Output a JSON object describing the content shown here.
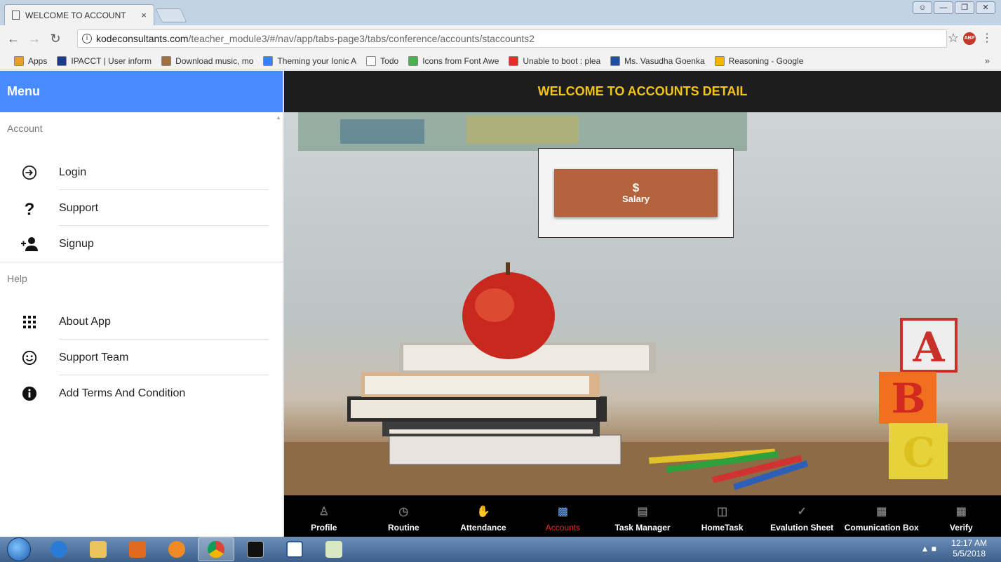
{
  "browser": {
    "tab_title": "WELCOME TO ACCOUNT",
    "tab_close": "×",
    "url_host": "kodeconsultants.com",
    "url_path": "/teacher_module3/#/nav/app/tabs-page3/tabs/conference/accounts/staccounts2",
    "bookmarks": [
      {
        "label": "Apps",
        "icon": "apps-icon",
        "color": "#e7a02e"
      },
      {
        "label": "IPACCT | User inform",
        "icon": "ipacct-icon",
        "color": "#1b3a8a"
      },
      {
        "label": "Download music, mo",
        "icon": "music-icon",
        "color": "#a07040"
      },
      {
        "label": "Theming your Ionic A",
        "icon": "ionic-icon",
        "color": "#3880ff"
      },
      {
        "label": "Todo",
        "icon": "page-icon",
        "color": "#ffffff"
      },
      {
        "label": "Icons from Font Awe",
        "icon": "fontawesome-icon",
        "color": "#4caf50"
      },
      {
        "label": "Unable to boot : plea",
        "icon": "youtube-icon",
        "color": "#e52d27"
      },
      {
        "label": "Ms. Vasudha Goenka",
        "icon": "p-icon",
        "color": "#1e4fa3"
      },
      {
        "label": "Reasoning - Google",
        "icon": "drive-icon",
        "color": "#f4b400"
      }
    ],
    "more": "»"
  },
  "menu": {
    "title": "Menu",
    "sections": [
      {
        "label": "Account",
        "items": [
          {
            "label": "Login",
            "icon": "login-icon"
          },
          {
            "label": "Support",
            "icon": "help-icon"
          },
          {
            "label": "Signup",
            "icon": "person-add-icon"
          }
        ]
      },
      {
        "label": "Help",
        "items": [
          {
            "label": "About App",
            "icon": "apps-grid-icon"
          },
          {
            "label": "Support Team",
            "icon": "smiley-icon"
          },
          {
            "label": "Add Terms And Condition",
            "icon": "info-icon"
          }
        ]
      }
    ]
  },
  "header": {
    "title": "WELCOME TO ACCOUNTS DETAIL",
    "title_color": "#f5c418"
  },
  "card": {
    "symbol": "$",
    "label": "Salary",
    "button_color": "#b5633d"
  },
  "tabs": [
    {
      "label": "Profile",
      "icon": "person-icon"
    },
    {
      "label": "Routine",
      "icon": "clock-icon"
    },
    {
      "label": "Attendance",
      "icon": "hand-icon"
    },
    {
      "label": "Accounts",
      "icon": "cash-icon",
      "active": true
    },
    {
      "label": "Task Manager",
      "icon": "clipboard-icon"
    },
    {
      "label": "HomeTask",
      "icon": "book-icon"
    },
    {
      "label": "Evalution Sheet",
      "icon": "checkmark-icon"
    },
    {
      "label": "Comunication Box",
      "icon": "chat-icon"
    },
    {
      "label": "Verify",
      "icon": "calculator-icon"
    }
  ],
  "taskbar": {
    "time": "12:17 AM",
    "date": "5/5/2018"
  }
}
